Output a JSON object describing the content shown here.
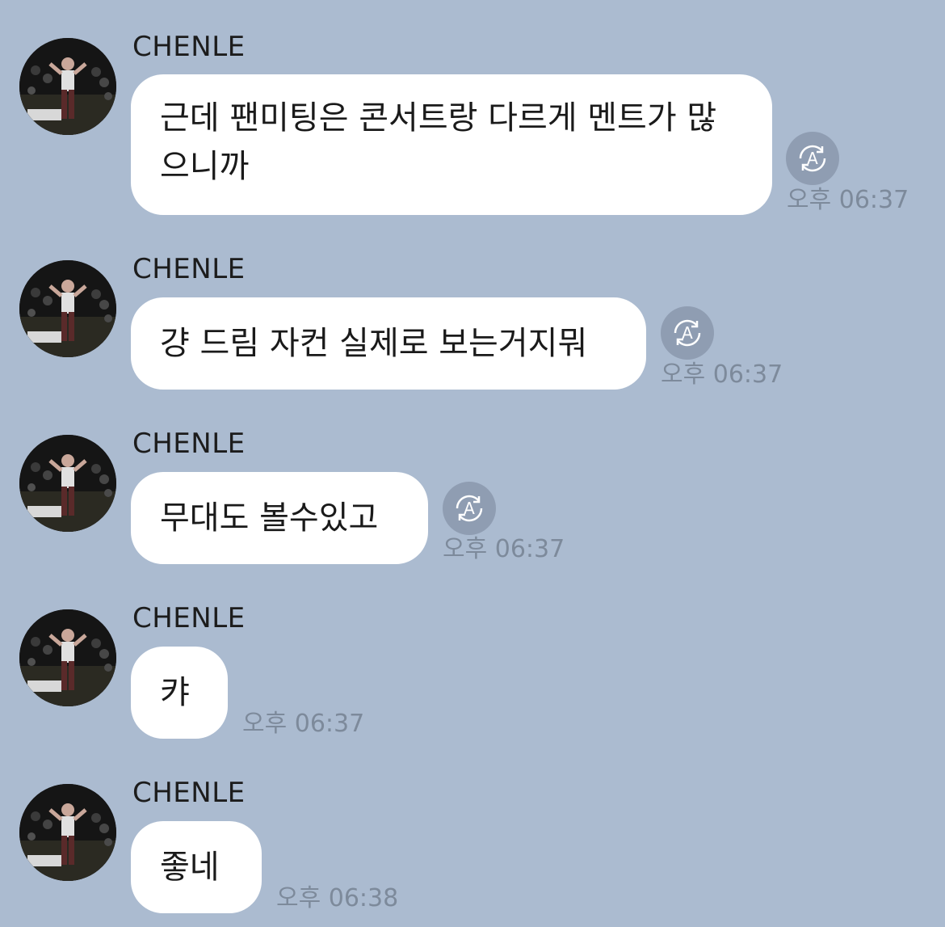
{
  "colors": {
    "background": "#abbbd0",
    "bubble": "#ffffff",
    "timestamp": "#7d8a9b",
    "translate_button": "#8f9db2"
  },
  "messages": [
    {
      "sender": "CHENLE",
      "lines": [
        "근데 팬미팅은 콘서트랑 다르게 멘트가 많",
        "으니까"
      ],
      "time": "오후 06:37",
      "translate_icon": "translate-icon"
    },
    {
      "sender": "CHENLE",
      "lines": [
        "걍 드림 자컨 실제로 보는거지뭐"
      ],
      "time": "오후 06:37",
      "translate_icon": "translate-icon"
    },
    {
      "sender": "CHENLE",
      "lines": [
        "무대도 볼수있고"
      ],
      "time": "오후 06:37",
      "translate_icon": "translate-icon"
    },
    {
      "sender": "CHENLE",
      "lines": [
        "캬"
      ],
      "time": "오후 06:37"
    },
    {
      "sender": "CHENLE",
      "lines": [
        "좋네"
      ],
      "time": "오후 06:38"
    }
  ]
}
